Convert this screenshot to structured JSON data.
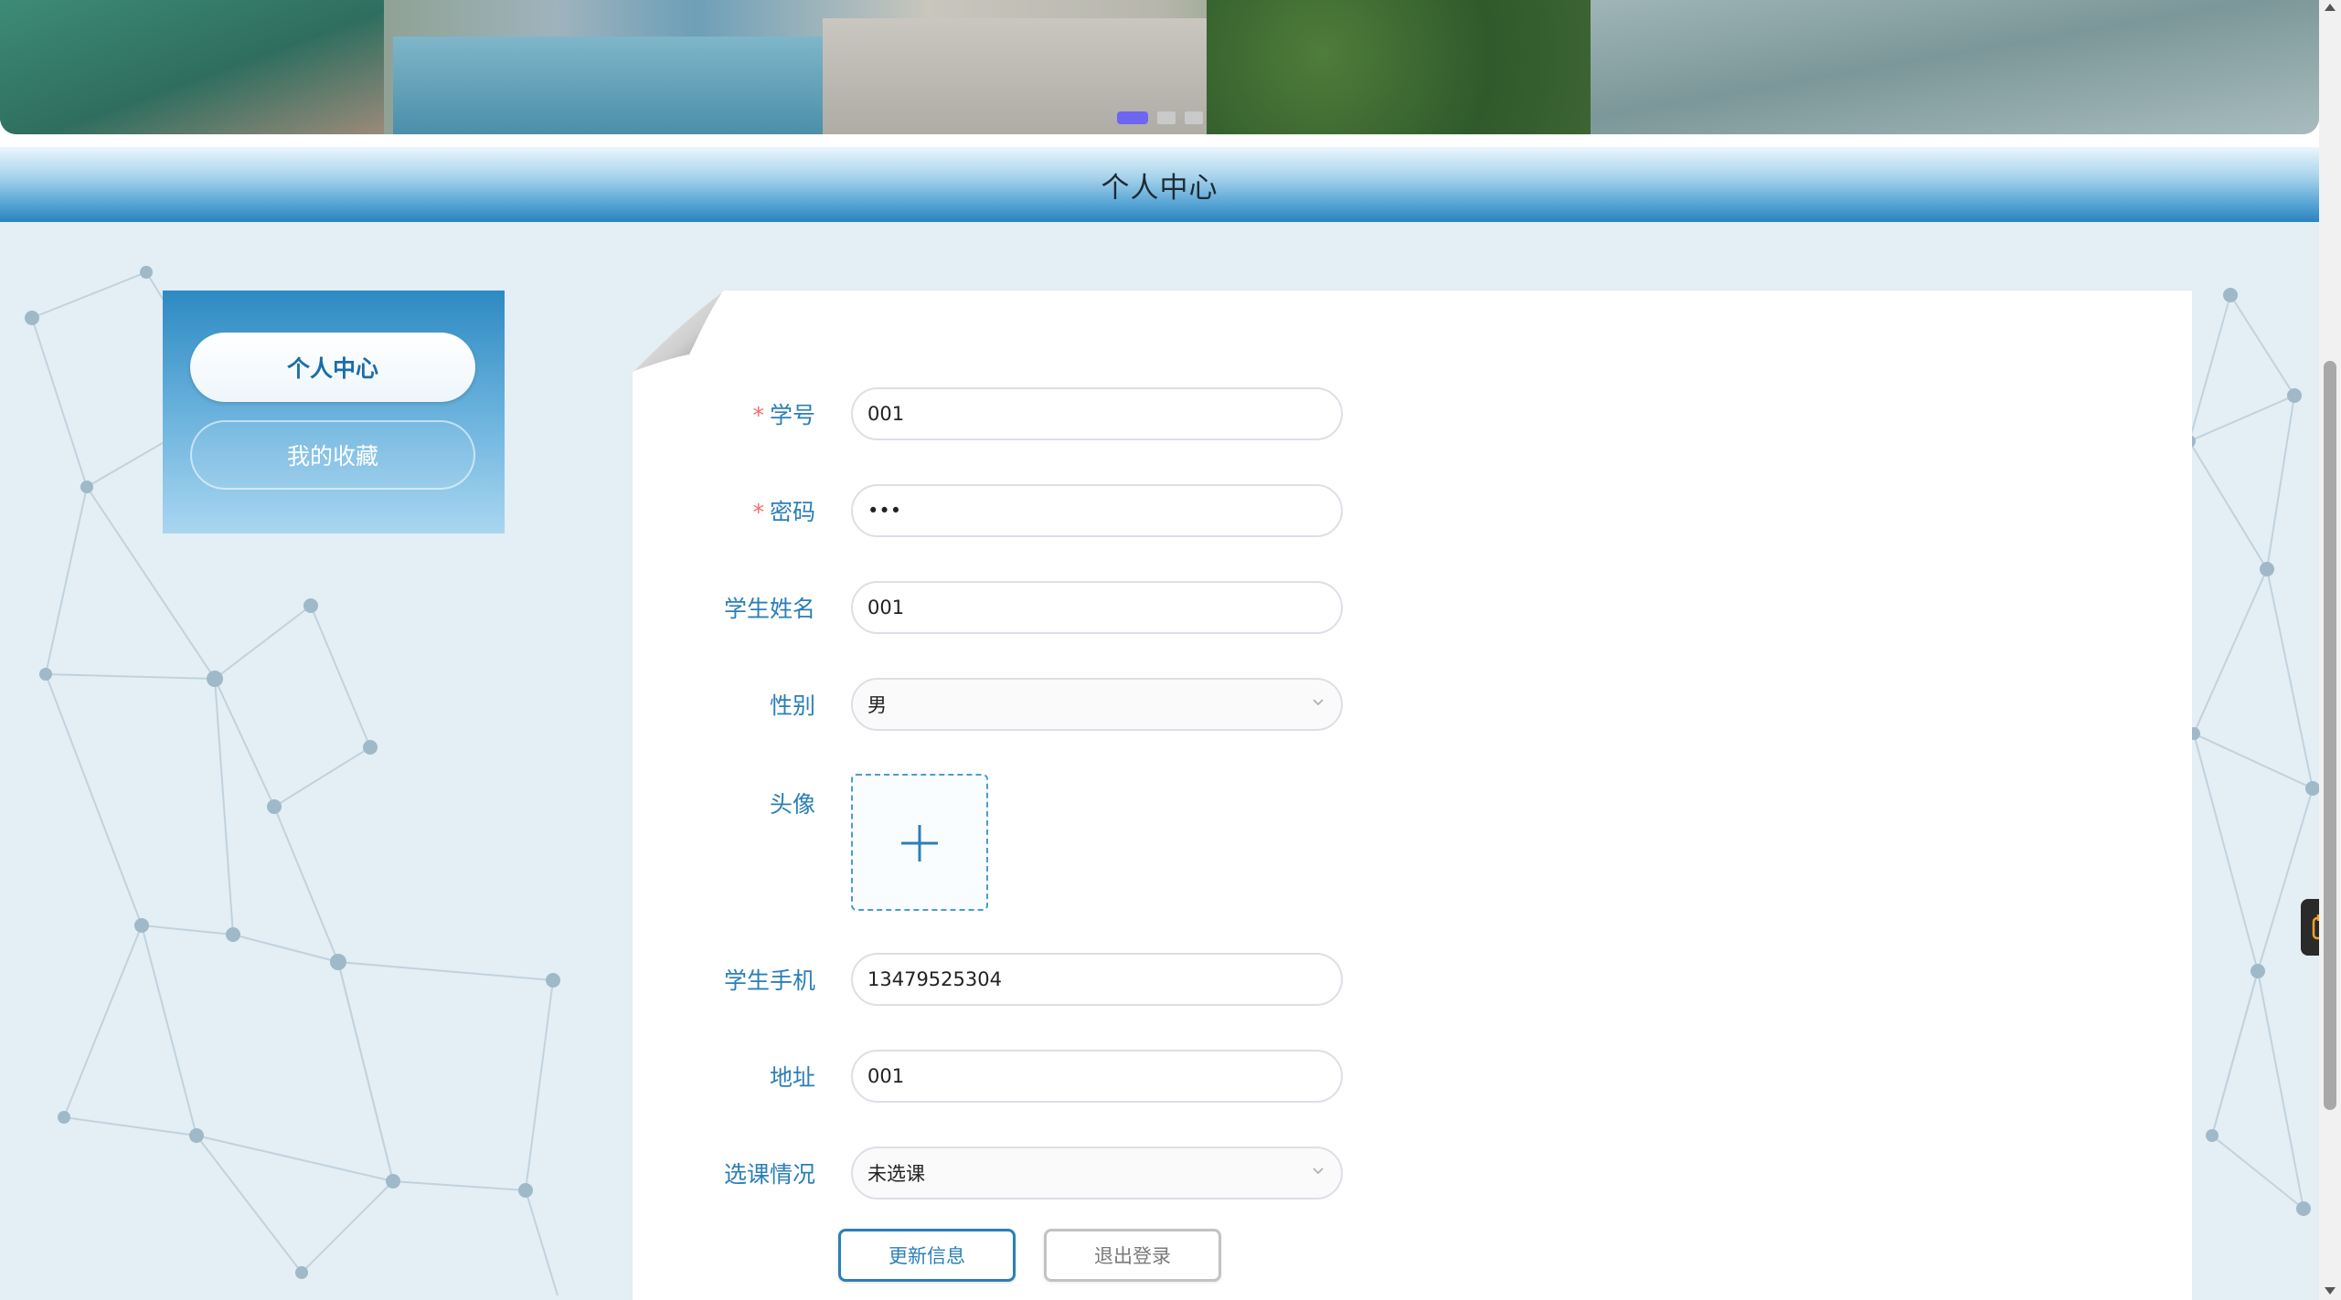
{
  "header": {
    "title": "个人中心"
  },
  "banner": {
    "slides": 3,
    "active_slide": 1
  },
  "sidebar": {
    "items": [
      {
        "label": "个人中心",
        "active": true
      },
      {
        "label": "我的收藏",
        "active": false
      }
    ]
  },
  "form": {
    "student_no": {
      "label": "学号",
      "required": true,
      "value": "001"
    },
    "password": {
      "label": "密码",
      "required": true,
      "value": "•••"
    },
    "student_name": {
      "label": "学生姓名",
      "required": false,
      "value": "001"
    },
    "gender": {
      "label": "性别",
      "required": false,
      "value": "男"
    },
    "avatar": {
      "label": "头像",
      "required": false
    },
    "phone": {
      "label": "学生手机",
      "required": false,
      "value": "13479525304"
    },
    "address": {
      "label": "地址",
      "required": false,
      "value": "001"
    },
    "course_status": {
      "label": "选课情况",
      "required": false,
      "value": "未选课"
    },
    "required_mark": "*"
  },
  "buttons": {
    "update": "更新信息",
    "logout": "退出登录"
  },
  "colors": {
    "accent": "#2b7fb8",
    "required": "#f56c6c",
    "carousel_active": "#6e65f0"
  }
}
